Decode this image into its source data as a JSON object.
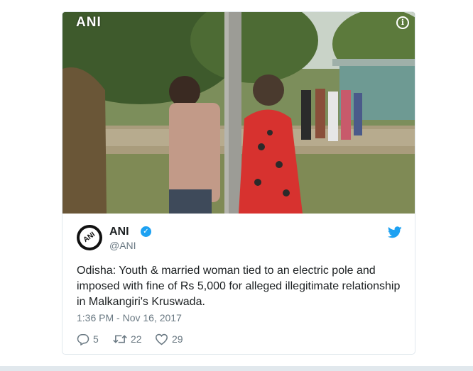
{
  "media": {
    "watermark": "ANI",
    "info_icon": "info-icon"
  },
  "author": {
    "avatar_text": "ANI",
    "name": "ANI",
    "handle": "@ANI"
  },
  "tweet": {
    "text": "Odisha: Youth & married woman tied to an electric pole and imposed with fine of Rs 5,000 for alleged illegitimate relationship in Malkangiri's Kruswada.",
    "timestamp": "1:36 PM - Nov 16, 2017"
  },
  "actions": {
    "replies": "5",
    "retweets": "22",
    "likes": "29"
  },
  "colors": {
    "twitter_blue": "#1da1f2",
    "meta_gray": "#697882",
    "text": "#1c2022"
  }
}
